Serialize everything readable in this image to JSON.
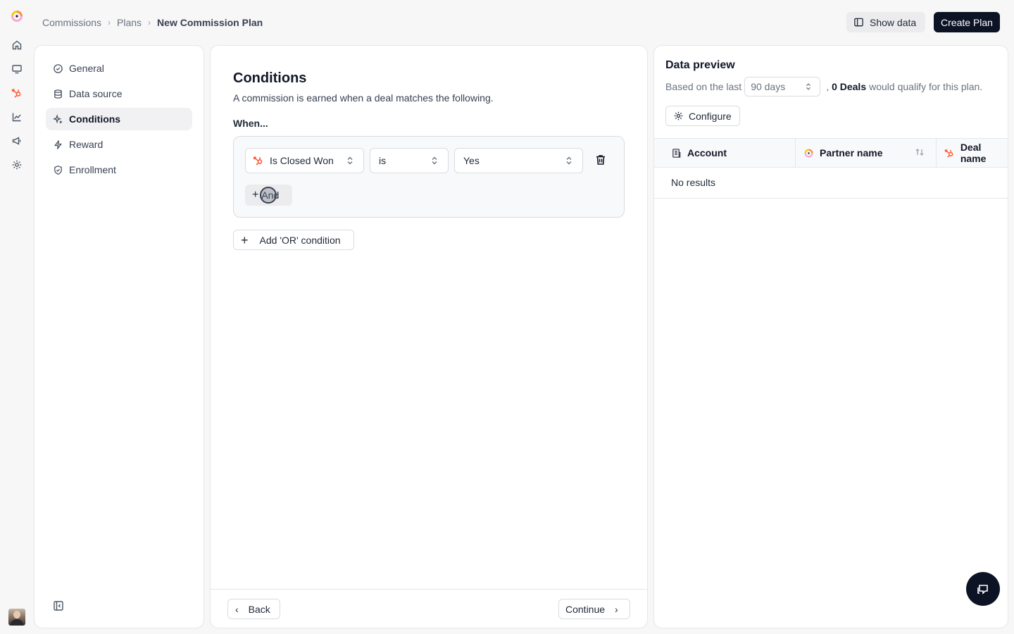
{
  "colors": {
    "hubspot_orange": "#ff5c35",
    "primary_dark": "#0b1324",
    "active_nav_bg": "#f1f1f3"
  },
  "rail": {
    "icons": [
      "app-logo-icon",
      "home-icon",
      "monitor-icon",
      "hubspot-icon",
      "chart-icon",
      "megaphone-icon",
      "gear-icon",
      "avatar"
    ]
  },
  "breadcrumb": {
    "items": [
      "Commissions",
      "Plans"
    ],
    "current": "New Commission Plan"
  },
  "header": {
    "show_data_label": "Show data",
    "create_plan_label": "Create Plan"
  },
  "sidebar": {
    "items": [
      {
        "label": "General",
        "icon": "check-circle-icon"
      },
      {
        "label": "Data source",
        "icon": "database-icon"
      },
      {
        "label": "Conditions",
        "icon": "sparkles-icon",
        "active": true
      },
      {
        "label": "Reward",
        "icon": "lightning-icon"
      },
      {
        "label": "Enrollment",
        "icon": "shield-check-icon"
      }
    ]
  },
  "conditions": {
    "title": "Conditions",
    "subtitle": "A commission is earned when a deal matches the following.",
    "when_label": "When...",
    "rule": {
      "field": "Is Closed Won",
      "operator": "is",
      "value": "Yes"
    },
    "and_label": "And",
    "or_label": "Add 'OR' condition"
  },
  "footer": {
    "back_label": "Back",
    "continue_label": "Continue"
  },
  "preview": {
    "title": "Data preview",
    "based_on": "Based on the last",
    "days_value": "90 days",
    "comma": ",",
    "deal_count": "0 Deals",
    "qualify_text": "would qualify for this plan.",
    "configure_label": "Configure",
    "columns": [
      "Account",
      "Partner name",
      "Deal name"
    ],
    "empty_text": "No results"
  }
}
